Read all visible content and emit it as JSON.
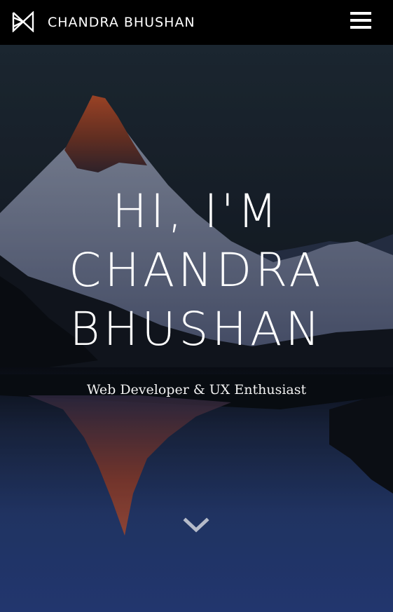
{
  "navbar": {
    "brand": "CHANDRA BHUSHAN",
    "logo_icon": "bowtie-logo-icon",
    "menu_icon": "hamburger-menu-icon"
  },
  "hero": {
    "headline_lines": [
      "HI, I'M",
      "CHANDRA",
      "BHUSHAN"
    ],
    "subtitle": "Web Developer & UX Enthusiast",
    "scroll_icon": "chevron-down-icon"
  },
  "colors": {
    "navbar_bg": "#000000",
    "text": "#ffffff",
    "peak_glow": "#c4542d",
    "sky": "#1e2a38",
    "water": "#2a4280"
  }
}
